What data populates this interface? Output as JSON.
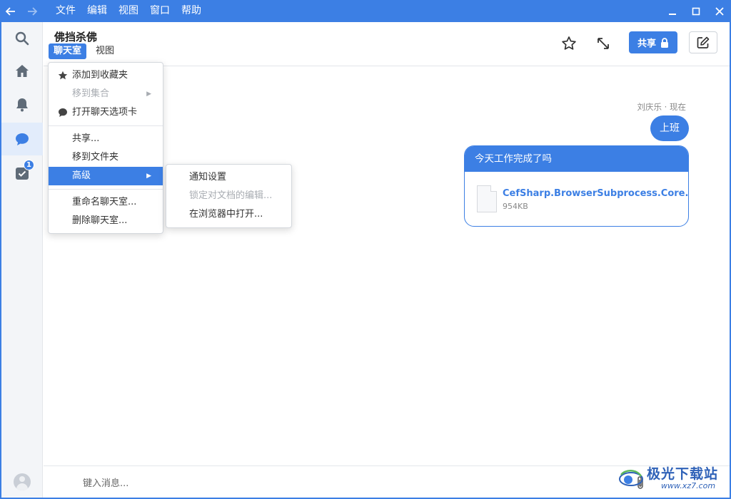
{
  "titlebar": {
    "back_icon": "arrow-left-icon",
    "forward_icon": "arrow-right-icon",
    "menus": [
      "文件",
      "编辑",
      "视图",
      "窗口",
      "帮助"
    ],
    "controls": [
      "minimize-icon",
      "maximize-icon",
      "close-icon"
    ]
  },
  "sidebar": {
    "items": [
      {
        "icon": "search-icon"
      },
      {
        "icon": "home-icon"
      },
      {
        "icon": "bell-icon"
      },
      {
        "icon": "chat-icon",
        "active": true
      },
      {
        "icon": "tasks-icon",
        "badge": "1"
      }
    ]
  },
  "header": {
    "title": "佛挡杀佛",
    "tab_chat": "聊天室",
    "tab_view": "视图",
    "share_label": "共享"
  },
  "messages": {
    "meta": "刘庆乐 · 现在",
    "bubble": "上班",
    "card_title": "今天工作完成了吗",
    "file_name": "CefSharp.BrowserSubprocess.Core.dll",
    "file_size": "954KB"
  },
  "input": {
    "placeholder": "键入消息..."
  },
  "context_menu": {
    "items": [
      {
        "label": "添加到收藏夹",
        "icon": "star-icon"
      },
      {
        "label": "移到集合",
        "disabled": true,
        "submenu": true
      },
      {
        "label": "打开聊天选项卡",
        "icon": "chat-bubble-icon"
      },
      {
        "label": "共享..."
      },
      {
        "label": "移到文件夹"
      },
      {
        "label": "高级",
        "highlighted": true,
        "submenu": true
      },
      {
        "label": "重命名聊天室..."
      },
      {
        "label": "删除聊天室..."
      }
    ]
  },
  "submenu": {
    "items": [
      {
        "label": "通知设置"
      },
      {
        "label": "锁定对文档的编辑...",
        "disabled": true
      },
      {
        "label": "在浏览器中打开..."
      }
    ]
  },
  "watermark": {
    "text": "极光下载站",
    "url": "www.xz7.com"
  },
  "colors": {
    "accent": "#3c7fe4",
    "sidebar_bg": "#f3f5f8"
  }
}
